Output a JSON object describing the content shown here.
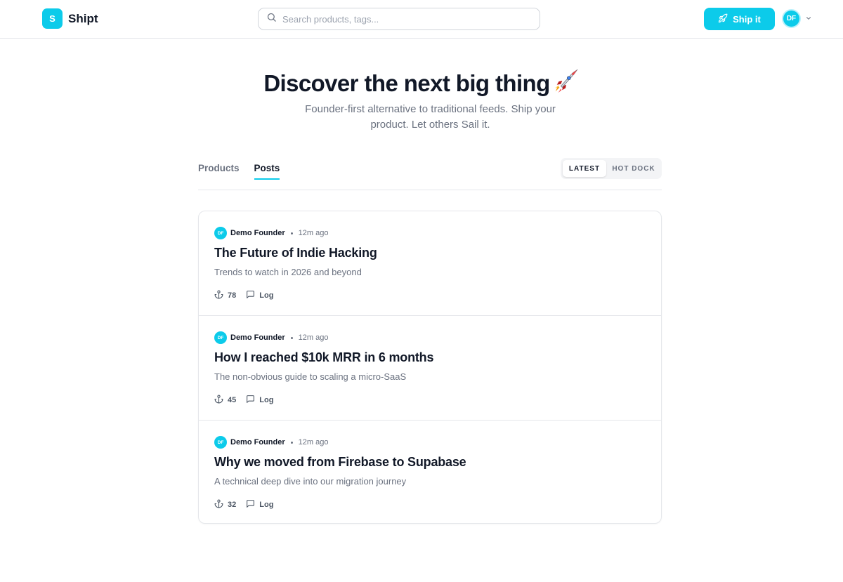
{
  "header": {
    "logo_letter": "S",
    "logo_text": "Shipt",
    "search_placeholder": "Search products, tags...",
    "ship_button_label": "Ship it",
    "user_initials": "DF"
  },
  "hero": {
    "title": "Discover the next big thing",
    "subtitle": "Founder-first alternative to traditional feeds. Ship your product. Let others Sail it."
  },
  "tabs": [
    {
      "label": "Products",
      "active": false
    },
    {
      "label": "Posts",
      "active": true
    }
  ],
  "sort": [
    {
      "label": "LATEST",
      "active": true
    },
    {
      "label": "HOT DOCK",
      "active": false
    }
  ],
  "posts": [
    {
      "author_initials": "DF",
      "author": "Demo Founder",
      "time": "12m ago",
      "title": "The Future of Indie Hacking",
      "description": "Trends to watch in 2026 and beyond",
      "anchors": "78",
      "log_label": "Log"
    },
    {
      "author_initials": "DF",
      "author": "Demo Founder",
      "time": "12m ago",
      "title": "How I reached $10k MRR in 6 months",
      "description": "The non-obvious guide to scaling a micro-SaaS",
      "anchors": "45",
      "log_label": "Log"
    },
    {
      "author_initials": "DF",
      "author": "Demo Founder",
      "time": "12m ago",
      "title": "Why we moved from Firebase to Supabase",
      "description": "A technical deep dive into our migration journey",
      "anchors": "32",
      "log_label": "Log"
    }
  ],
  "colors": {
    "accent": "#0ccbea",
    "text": "#111827",
    "muted": "#6b7280",
    "border": "#e5e7eb"
  },
  "icons": [
    "search-icon",
    "rocket-icon",
    "chevron-down-icon",
    "anchor-icon",
    "comment-icon",
    "rocket-emoji"
  ]
}
